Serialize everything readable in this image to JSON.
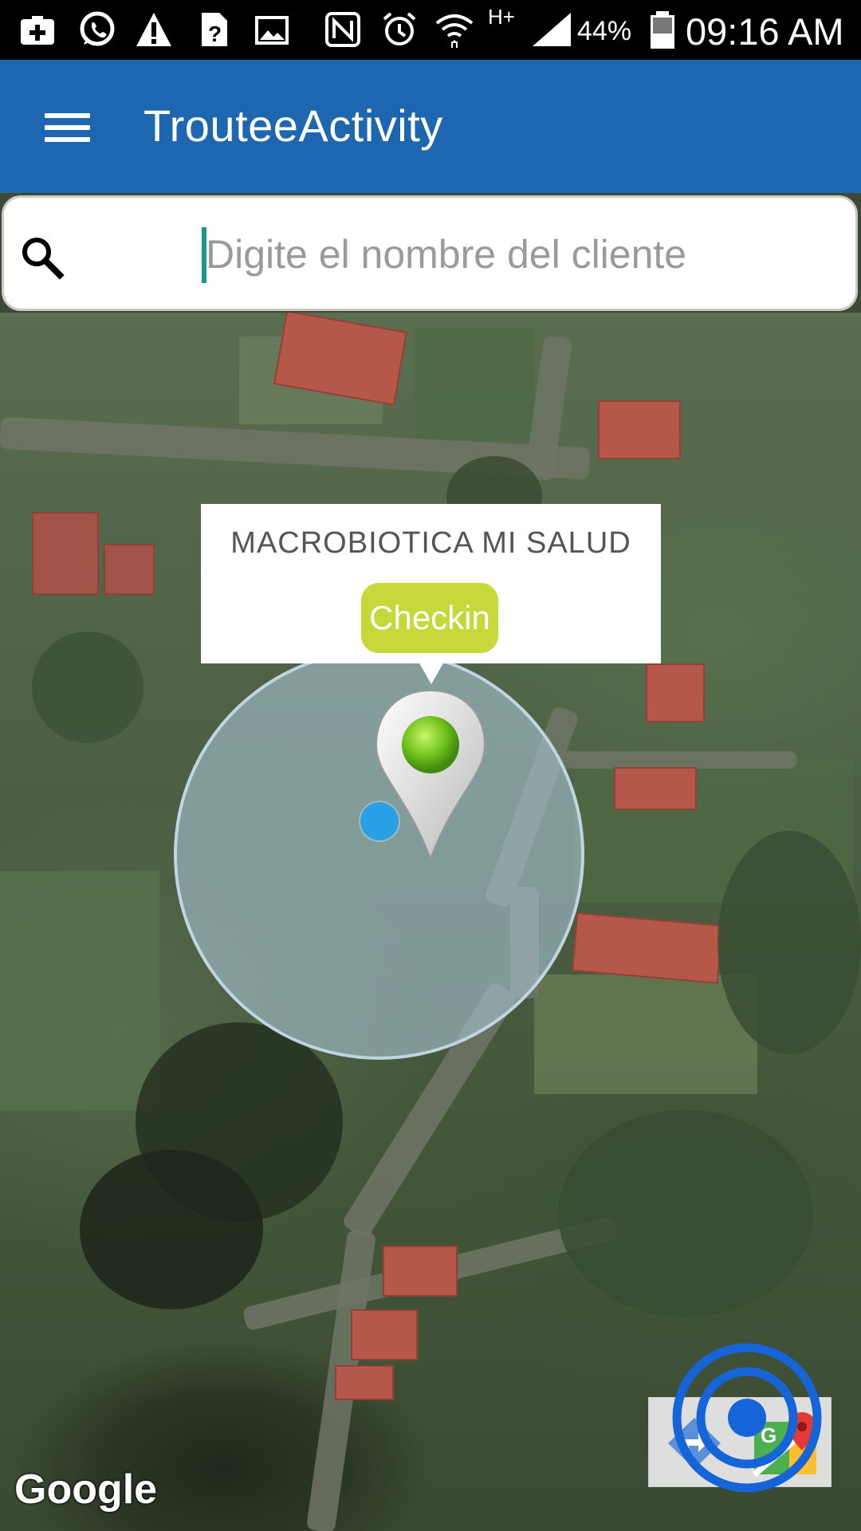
{
  "status_bar": {
    "network": "H+",
    "battery": "44%",
    "time": "09:16 AM"
  },
  "app_bar": {
    "title": "TrouteeActivity"
  },
  "search": {
    "placeholder": "Digite el nombre del cliente",
    "value": ""
  },
  "info_window": {
    "title": "MACROBIOTICA MI SALUD",
    "button_label": "Checkin"
  },
  "map": {
    "attribution": "Google",
    "colors": {
      "appbar": "#1e67b0",
      "checkin": "#c6d83a",
      "location_dot": "#2aa0e6",
      "fab_ring": "#1565d8"
    }
  }
}
